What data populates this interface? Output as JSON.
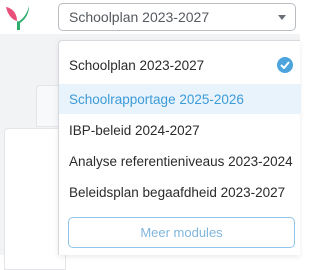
{
  "colors": {
    "accent": "#4da4dd",
    "active_text": "#3d9bd8",
    "active_bg": "#e8f3fb",
    "logo_pink": "#e8507a",
    "logo_green": "#2fae6b"
  },
  "icons": {
    "logo": "logo-leaf-icon",
    "chevron": "chevron-down-icon",
    "check": "check-circle-icon"
  },
  "module_select": {
    "value": "Schoolplan 2023-2027"
  },
  "dropdown": {
    "options": [
      {
        "label": "Schoolplan 2023-2027",
        "selected": true
      },
      {
        "label": "Schoolrapportage 2025-2026",
        "highlighted": true
      },
      {
        "label": "IBP-beleid 2024-2027"
      },
      {
        "label": "Analyse referentieniveaus 2023-2024"
      },
      {
        "label": "Beleidsplan begaafdheid 2023-2027"
      }
    ],
    "more_button": "Meer modules"
  }
}
